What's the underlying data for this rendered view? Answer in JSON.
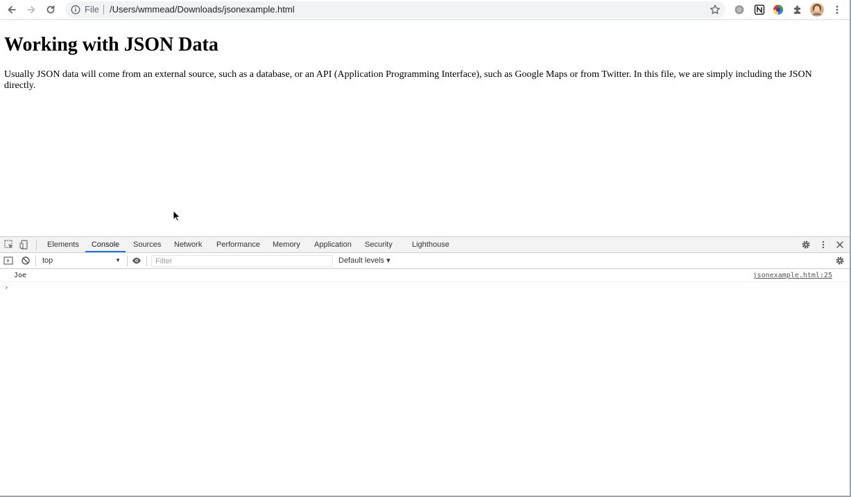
{
  "browser": {
    "address_scheme": "File",
    "address_url": "/Users/wmmead/Downloads/jsonexample.html",
    "icons": [
      "back-icon",
      "forward-icon",
      "reload-icon",
      "info-icon",
      "star-icon",
      "extension-gray-icon",
      "notion-icon",
      "color-extension-icon",
      "puzzle-icon",
      "profile-avatar",
      "more-vert-icon"
    ]
  },
  "page": {
    "heading": "Working with JSON Data",
    "paragraph": "Usually JSON data will come from an external source, such as a database, or an API (Application Programming Interface), such as Google Maps or from Twitter. In this file, we are simply including the JSON directly."
  },
  "devtools": {
    "tabs": [
      "Elements",
      "Console",
      "Sources",
      "Network",
      "Performance",
      "Memory",
      "Application",
      "Security",
      "Lighthouse"
    ],
    "active_tab": "Console",
    "context": "top",
    "filter_placeholder": "Filter",
    "levels_label": "Default levels ▾",
    "logs": [
      {
        "message": "Joe",
        "source": "jsonexample.html:25"
      }
    ],
    "prompt_glyph": "›",
    "accent_color": "#1a73e8"
  }
}
